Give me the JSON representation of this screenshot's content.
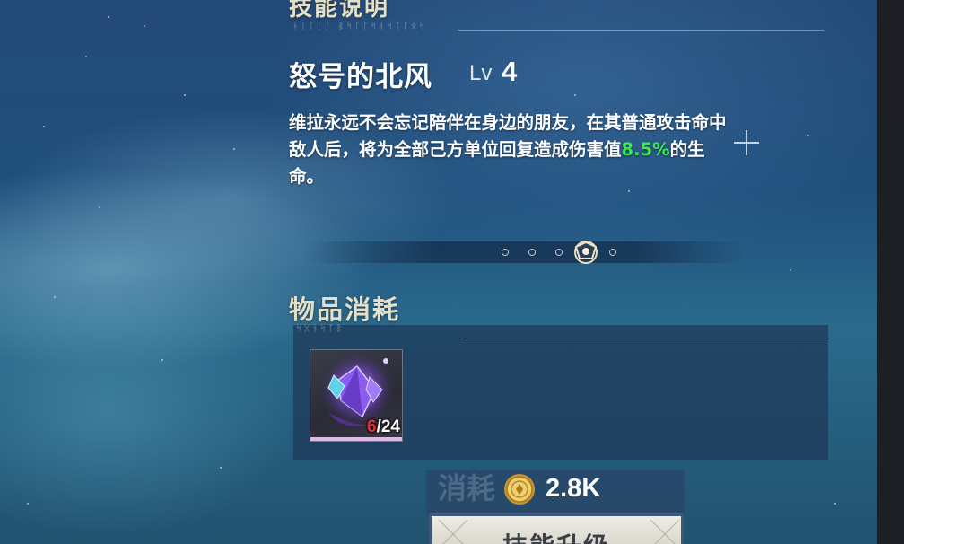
{
  "skill_section": {
    "title": "技能说明",
    "runes": "ᚾᛁᚴᛚᛚ ᛒᛋᚴᛚᛋᚾᛋᛏᚴᛟᛋ"
  },
  "skill": {
    "name": "怒号的北风",
    "level_prefix": "Lv",
    "level_value": "4",
    "description_part1": "维拉永远不会忘记陪伴在身边的朋友，在其普通攻击命中敌人后，将为全部己方单位回复造成伤害值",
    "description_highlight": "8.5%",
    "description_part2": "的生命。",
    "current_level": 4,
    "max_level": 5
  },
  "item_section": {
    "title": "物品消耗",
    "runes": "ᛋᚷᚾᛋᚴᛒ",
    "item": {
      "icon": "purple-crystal-material-icon",
      "owned": "6",
      "required": "/24"
    }
  },
  "cost": {
    "bg_label": "消耗",
    "icon": "gold-coin-icon",
    "value": "2.8K"
  },
  "upgrade_button": {
    "label": "技能升级"
  },
  "colors": {
    "highlight": "#3ee65a",
    "owned_insufficient": "#e2333a",
    "background": "#244a78"
  }
}
